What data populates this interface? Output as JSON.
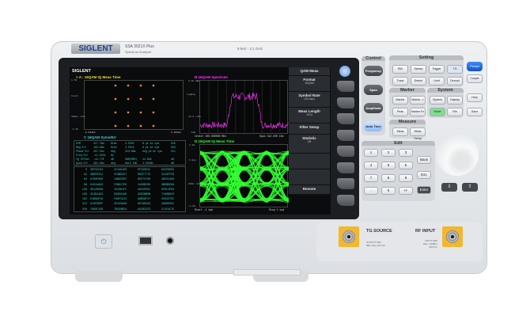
{
  "device": {
    "brand": "SIGLENT",
    "model": "SSA 3021X Plus",
    "subtitle": "Spectrum Analyzer",
    "freq_range": "9 kHz - 2.1 GHz"
  },
  "screen": {
    "brand": "SIGLENT",
    "panel_a": {
      "title": "> A : 16QAM IQ Meas Time",
      "y_top": "1.50",
      "y_mid": "Const",
      "y_low": "300mu\n/div",
      "y_bot": "-1.50",
      "x_left": "-2.34413",
      "x_right": "2.34413"
    },
    "panel_b": {
      "title": "B 16QAM Spectrum",
      "y_top": "0.00 dBm",
      "y_mid": "LogMag",
      "y_low": "10.0 /div",
      "y_bot": "-100",
      "center": "Center 100.000000 MHz",
      "span": "Span 312.500 kHz"
    },
    "panel_c": {
      "title": "C 16QAM Syms/Err",
      "metrics": [
        [
          "EVM",
          "217.79m",
          "%rms",
          "3.5520",
          "% pk at sym",
          "920"
        ],
        [
          "Mag Err",
          "182.06m",
          "%rms",
          "3.5519",
          "% pk at sym",
          "920"
        ],
        [
          "Phase Err",
          "107.51m",
          "deg",
          "323.68m",
          "deg pk at sym",
          "211"
        ],
        [
          "Freq Err",
          "-11.021m",
          "Hz",
          "",
          "",
          ""
        ],
        [
          "IQ Offset",
          "-44.778",
          "dB",
          "SNR(MER)",
          "44.986",
          "dB"
        ],
        [
          "Quad Err",
          "381.83m",
          "deg",
          "Gain Imb",
          "3.5209m",
          "dB"
        ]
      ],
      "symbols": [
        [
          "0",
          "3EF92C64",
          "2214A1D6",
          "0F32091C",
          "63CE6683"
        ],
        [
          "32",
          "3B6FD251",
          "CFAB5257",
          "D6CF7775",
          "3124FF56"
        ],
        [
          "64",
          "A7D6F890",
          "13BACDB7",
          "DEE74790",
          "3AF81480"
        ],
        [
          "96",
          "81D14A63",
          "F2B817E0",
          "CA30BCB5",
          "3BEB6E9A"
        ],
        [
          "128",
          "3812DA09",
          "1533D1FC",
          "A461EEDC",
          "3F8C1DE6"
        ],
        [
          "160",
          "3C3EA1D3",
          "E99E61A0",
          "A3D5BB8B",
          "7106B6C0"
        ],
        [
          "192",
          "E1B6AF56",
          "F6AFCA13",
          "A9B5AF47",
          "2561E7EC"
        ],
        [
          "224",
          "A7AF9D0F",
          "2E443A0A",
          "A67AD829",
          "386DD0D1"
        ],
        [
          "256",
          "7A85F1E6",
          "7B1E0BCA",
          "A428C2CD",
          "CC1F4C7E"
        ]
      ]
    },
    "panel_d": {
      "title": "D 16QAM IQ Meas Time",
      "y_top": "1.80",
      "y_mid": "I-Eye",
      "y_low": "300m /div",
      "y_bot": "-1.80",
      "start": "Start -1 sym",
      "stop": "Stop 1 sym"
    },
    "softkeys": [
      {
        "label": "QAM Meas",
        "value": ""
      },
      {
        "label": "Format",
        "value": "16QAM"
      },
      {
        "label": "Symbol Rate",
        "value": "100 ksps"
      },
      {
        "label": "Meas Length",
        "value": "1024"
      },
      {
        "label": "Filter Setup",
        "value": ""
      },
      {
        "label": "Statistic",
        "value": "Off"
      },
      {
        "label": "",
        "value": ""
      },
      {
        "label": "",
        "value": ""
      },
      {
        "label": "Remote",
        "value": ""
      }
    ],
    "constellation": [
      [
        -3,
        3
      ],
      [
        -1,
        3
      ],
      [
        1,
        3
      ],
      [
        3,
        3
      ],
      [
        -3,
        1
      ],
      [
        -1,
        1
      ],
      [
        1,
        1
      ],
      [
        3,
        1
      ],
      [
        -3,
        -1
      ],
      [
        -1,
        -1
      ],
      [
        1,
        -1
      ],
      [
        3,
        -1
      ],
      [
        -3,
        -3
      ],
      [
        -1,
        -3
      ],
      [
        1,
        -3
      ],
      [
        3,
        -3
      ]
    ]
  },
  "panel": {
    "control": {
      "label": "Control",
      "buttons": [
        "Frequency",
        "Span",
        "Amplitude",
        "Auto Tune"
      ]
    },
    "setting": {
      "label": "Setting",
      "buttons": [
        "BW",
        "Sweep",
        "Trigger",
        "TG",
        "Trace",
        "Detect",
        "Limit",
        "Demod"
      ]
    },
    "preset": "Preset",
    "couple": "Couple",
    "help": "Help",
    "save": "Save",
    "marker": {
      "label": "Marker",
      "buttons": [
        "Marker",
        "Marker ->",
        "Peak",
        "Marker Fn"
      ]
    },
    "system": {
      "label": "System",
      "buttons": [
        "System",
        "Display",
        "Mode",
        "File"
      ]
    },
    "measure": {
      "label": "Measure",
      "buttons": [
        "Meas",
        "Meas Setup"
      ]
    },
    "edit": {
      "label": "Edit",
      "keys": [
        "1",
        "2",
        "3",
        "4",
        "5",
        "6",
        "7",
        "8",
        "9",
        ".",
        "0",
        "+/-"
      ],
      "side": [
        "Back",
        "Esc",
        "Enter"
      ]
    }
  },
  "ports": {
    "tg": "TG SOURCE",
    "rf": "RF INPUT",
    "tg_note": "OUTPUT 50Ω\nREV Max 10V DC",
    "rf_note": "INPUT 50Ω\nMax +30dBm\n50V DC"
  },
  "colors": {
    "accent": "#1a6fe0",
    "mode": "#7fe08a",
    "trace_b": "#ff33ff",
    "trace_d": "#33ff33",
    "table": "#35d6d0",
    "port": "#f1b72f"
  }
}
